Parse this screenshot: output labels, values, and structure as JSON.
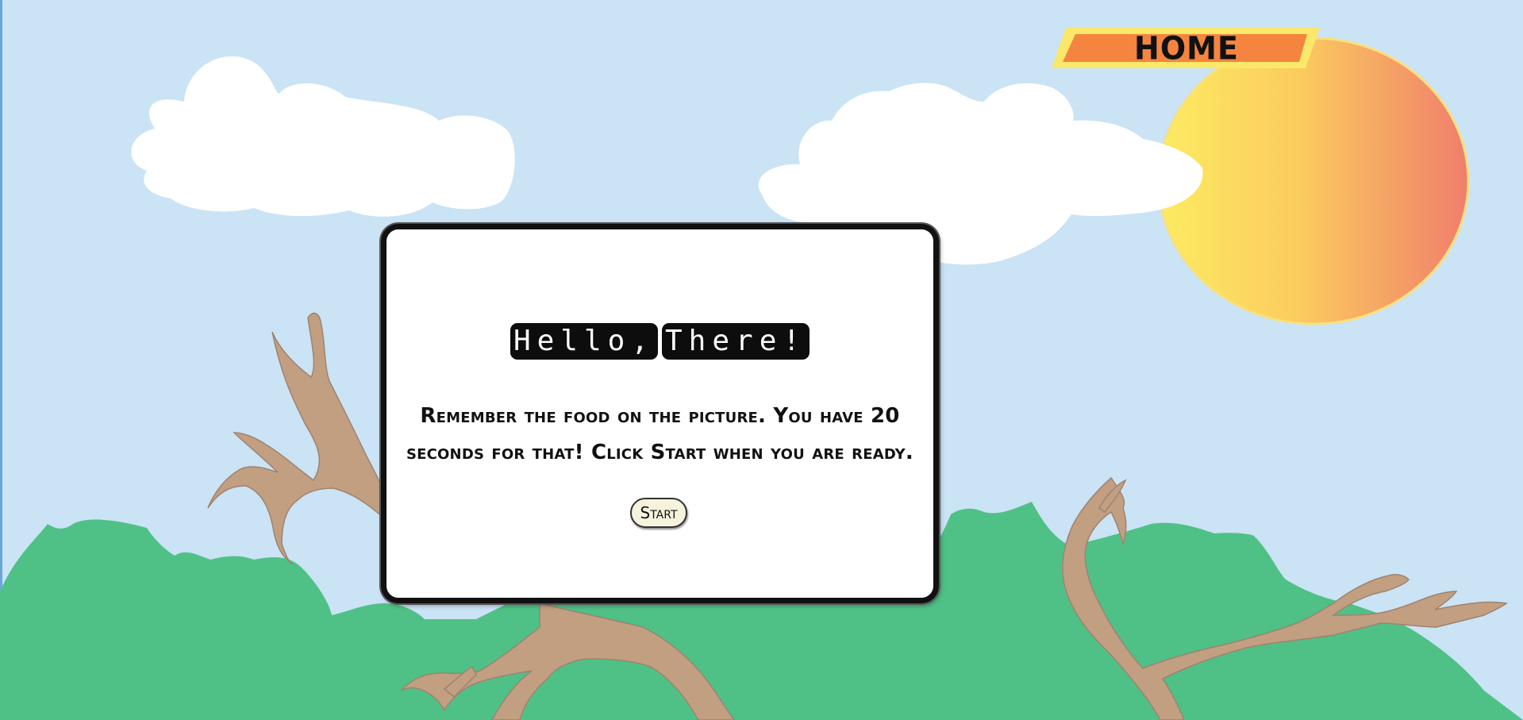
{
  "home": {
    "label": "HOME"
  },
  "dialog": {
    "title_words": [
      "Hello,",
      "There!"
    ],
    "message": "Remember the food on the picture. You have 20 seconds for that! Click Start when you are ready.",
    "start_label": "Start"
  },
  "colors": {
    "sky": "#cae3f5",
    "bush": "#4fc186",
    "branch": "#c29f81",
    "cloud": "#ffffff",
    "sun_start": "#fde45e",
    "sun_end": "#f0826c",
    "home_fill": "#f5843f",
    "home_border": "#fbe86a"
  }
}
